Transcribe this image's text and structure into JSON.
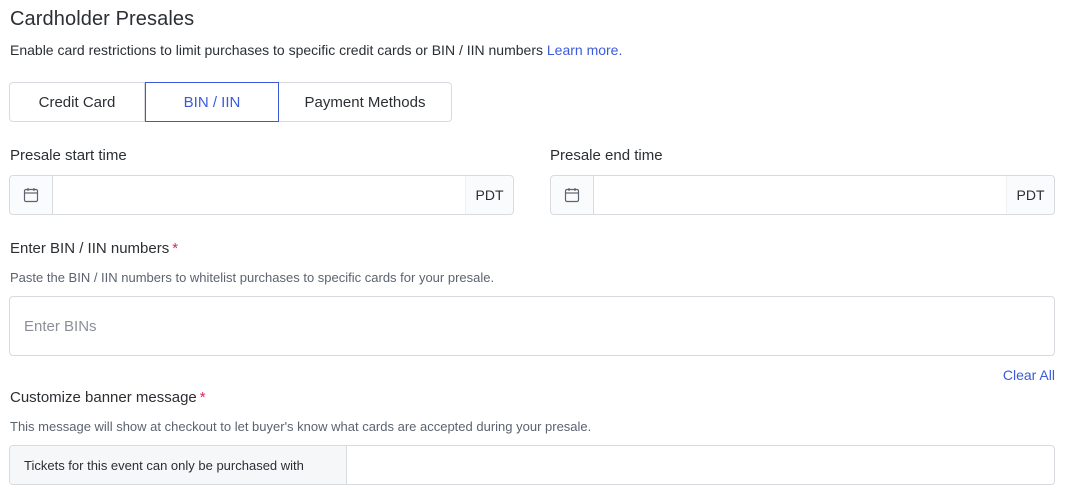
{
  "header": {
    "title": "Cardholder Presales",
    "description": "Enable card restrictions to limit purchases to specific credit cards or BIN / IIN numbers",
    "learn_more": "Learn more."
  },
  "tabs": [
    {
      "label": "Credit Card",
      "active": false
    },
    {
      "label": "BIN / IIN",
      "active": true
    },
    {
      "label": "Payment Methods",
      "active": false
    }
  ],
  "presale_start": {
    "label": "Presale start time",
    "value": "",
    "timezone": "PDT",
    "icon": "calendar-icon"
  },
  "presale_end": {
    "label": "Presale end time",
    "value": "",
    "timezone": "PDT",
    "icon": "calendar-icon"
  },
  "bin": {
    "label": "Enter BIN / IIN numbers",
    "required_mark": "*",
    "help": "Paste the BIN / IIN numbers to whitelist purchases to specific cards for your presale.",
    "placeholder": "Enter BINs",
    "value": "",
    "clear_all": "Clear All"
  },
  "banner": {
    "label": "Customize banner message",
    "required_mark": "*",
    "help": "This message will show at checkout to let buyer's know what cards are accepted during your presale.",
    "prefix": "Tickets for this event can only be purchased with",
    "value": ""
  },
  "colors": {
    "accent": "#3b5bdb",
    "required": "#e0245e",
    "border": "#d7dbe0"
  }
}
